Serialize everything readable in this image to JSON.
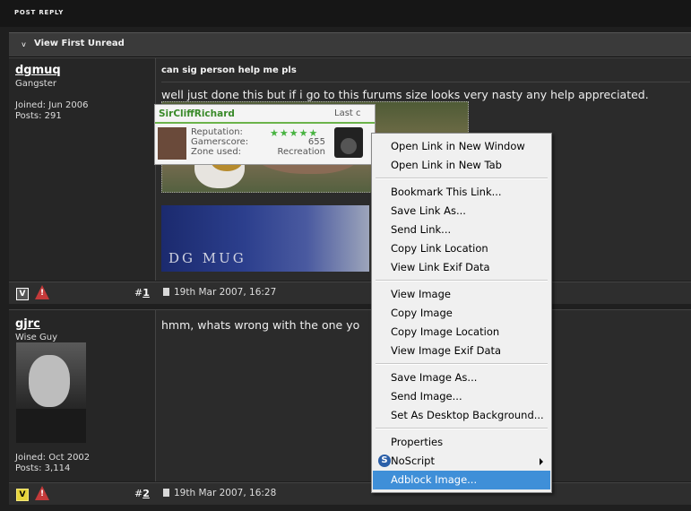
{
  "top": {
    "post_reply": "POST REPLY"
  },
  "unread": {
    "label": "View First Unread"
  },
  "posts": [
    {
      "username": "dgmuq",
      "user_title": "Gangster",
      "joined": "Joined: Jun 2006",
      "posts": "Posts: 291",
      "title": "can sig person help me pls",
      "text": "well just done this but if i go to this furums size looks very nasty any help appreciated.",
      "image2_text": "DG MUG",
      "number_prefix": "#",
      "number": "1",
      "date": "19th Mar 2007, 16:27"
    },
    {
      "username": "gjrc",
      "user_title": "Wise Guy",
      "joined": "Joined: Oct 2002",
      "posts": "Posts: 3,114",
      "text": "hmm, whats wrong with the one yo",
      "number_prefix": "#",
      "number": "2",
      "date": "19th Mar 2007, 16:28",
      "gamercard": {
        "name": "SirCliffRichard",
        "last": "Last c",
        "reputation_label": "Reputation:",
        "stars": "★★★★★",
        "gamerscore_label": "Gamerscore:",
        "gamerscore": "655",
        "zone_label": "Zone used:",
        "zone": "Recreation"
      }
    }
  ],
  "context_menu": {
    "items": [
      "Open Link in New Window",
      "Open Link in New Tab",
      "Bookmark This Link...",
      "Save Link As...",
      "Send Link...",
      "Copy Link Location",
      "View Link Exif Data",
      "View Image",
      "Copy Image",
      "Copy Image Location",
      "View Image Exif Data",
      "Save Image As...",
      "Send Image...",
      "Set As Desktop Background...",
      "Properties",
      "NoScript",
      "Adblock Image..."
    ],
    "highlighted": "Adblock Image...",
    "highlight_color": "#3f8fd8"
  }
}
